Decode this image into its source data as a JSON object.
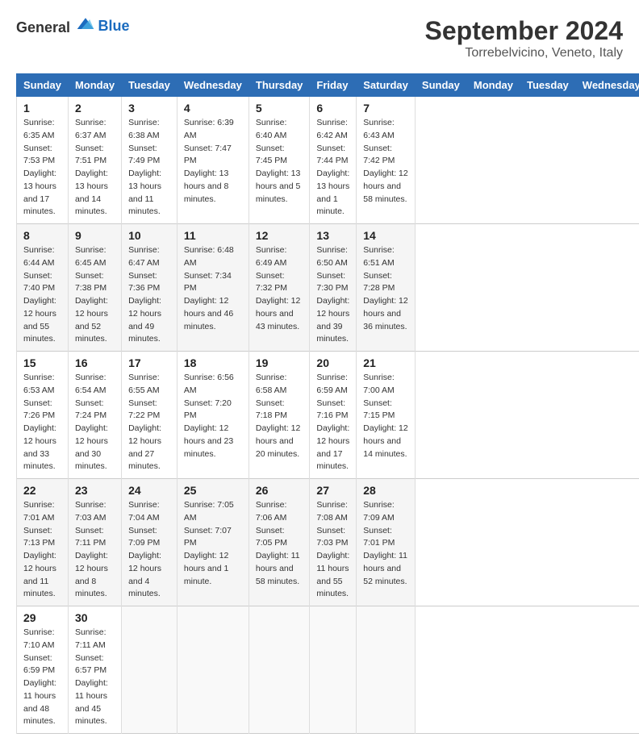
{
  "header": {
    "logo_general": "General",
    "logo_blue": "Blue",
    "month_title": "September 2024",
    "location": "Torrebelvicino, Veneto, Italy"
  },
  "columns": [
    "Sunday",
    "Monday",
    "Tuesday",
    "Wednesday",
    "Thursday",
    "Friday",
    "Saturday"
  ],
  "weeks": [
    [
      {
        "day": "1",
        "sunrise": "Sunrise: 6:35 AM",
        "sunset": "Sunset: 7:53 PM",
        "daylight": "Daylight: 13 hours and 17 minutes."
      },
      {
        "day": "2",
        "sunrise": "Sunrise: 6:37 AM",
        "sunset": "Sunset: 7:51 PM",
        "daylight": "Daylight: 13 hours and 14 minutes."
      },
      {
        "day": "3",
        "sunrise": "Sunrise: 6:38 AM",
        "sunset": "Sunset: 7:49 PM",
        "daylight": "Daylight: 13 hours and 11 minutes."
      },
      {
        "day": "4",
        "sunrise": "Sunrise: 6:39 AM",
        "sunset": "Sunset: 7:47 PM",
        "daylight": "Daylight: 13 hours and 8 minutes."
      },
      {
        "day": "5",
        "sunrise": "Sunrise: 6:40 AM",
        "sunset": "Sunset: 7:45 PM",
        "daylight": "Daylight: 13 hours and 5 minutes."
      },
      {
        "day": "6",
        "sunrise": "Sunrise: 6:42 AM",
        "sunset": "Sunset: 7:44 PM",
        "daylight": "Daylight: 13 hours and 1 minute."
      },
      {
        "day": "7",
        "sunrise": "Sunrise: 6:43 AM",
        "sunset": "Sunset: 7:42 PM",
        "daylight": "Daylight: 12 hours and 58 minutes."
      }
    ],
    [
      {
        "day": "8",
        "sunrise": "Sunrise: 6:44 AM",
        "sunset": "Sunset: 7:40 PM",
        "daylight": "Daylight: 12 hours and 55 minutes."
      },
      {
        "day": "9",
        "sunrise": "Sunrise: 6:45 AM",
        "sunset": "Sunset: 7:38 PM",
        "daylight": "Daylight: 12 hours and 52 minutes."
      },
      {
        "day": "10",
        "sunrise": "Sunrise: 6:47 AM",
        "sunset": "Sunset: 7:36 PM",
        "daylight": "Daylight: 12 hours and 49 minutes."
      },
      {
        "day": "11",
        "sunrise": "Sunrise: 6:48 AM",
        "sunset": "Sunset: 7:34 PM",
        "daylight": "Daylight: 12 hours and 46 minutes."
      },
      {
        "day": "12",
        "sunrise": "Sunrise: 6:49 AM",
        "sunset": "Sunset: 7:32 PM",
        "daylight": "Daylight: 12 hours and 43 minutes."
      },
      {
        "day": "13",
        "sunrise": "Sunrise: 6:50 AM",
        "sunset": "Sunset: 7:30 PM",
        "daylight": "Daylight: 12 hours and 39 minutes."
      },
      {
        "day": "14",
        "sunrise": "Sunrise: 6:51 AM",
        "sunset": "Sunset: 7:28 PM",
        "daylight": "Daylight: 12 hours and 36 minutes."
      }
    ],
    [
      {
        "day": "15",
        "sunrise": "Sunrise: 6:53 AM",
        "sunset": "Sunset: 7:26 PM",
        "daylight": "Daylight: 12 hours and 33 minutes."
      },
      {
        "day": "16",
        "sunrise": "Sunrise: 6:54 AM",
        "sunset": "Sunset: 7:24 PM",
        "daylight": "Daylight: 12 hours and 30 minutes."
      },
      {
        "day": "17",
        "sunrise": "Sunrise: 6:55 AM",
        "sunset": "Sunset: 7:22 PM",
        "daylight": "Daylight: 12 hours and 27 minutes."
      },
      {
        "day": "18",
        "sunrise": "Sunrise: 6:56 AM",
        "sunset": "Sunset: 7:20 PM",
        "daylight": "Daylight: 12 hours and 23 minutes."
      },
      {
        "day": "19",
        "sunrise": "Sunrise: 6:58 AM",
        "sunset": "Sunset: 7:18 PM",
        "daylight": "Daylight: 12 hours and 20 minutes."
      },
      {
        "day": "20",
        "sunrise": "Sunrise: 6:59 AM",
        "sunset": "Sunset: 7:16 PM",
        "daylight": "Daylight: 12 hours and 17 minutes."
      },
      {
        "day": "21",
        "sunrise": "Sunrise: 7:00 AM",
        "sunset": "Sunset: 7:15 PM",
        "daylight": "Daylight: 12 hours and 14 minutes."
      }
    ],
    [
      {
        "day": "22",
        "sunrise": "Sunrise: 7:01 AM",
        "sunset": "Sunset: 7:13 PM",
        "daylight": "Daylight: 12 hours and 11 minutes."
      },
      {
        "day": "23",
        "sunrise": "Sunrise: 7:03 AM",
        "sunset": "Sunset: 7:11 PM",
        "daylight": "Daylight: 12 hours and 8 minutes."
      },
      {
        "day": "24",
        "sunrise": "Sunrise: 7:04 AM",
        "sunset": "Sunset: 7:09 PM",
        "daylight": "Daylight: 12 hours and 4 minutes."
      },
      {
        "day": "25",
        "sunrise": "Sunrise: 7:05 AM",
        "sunset": "Sunset: 7:07 PM",
        "daylight": "Daylight: 12 hours and 1 minute."
      },
      {
        "day": "26",
        "sunrise": "Sunrise: 7:06 AM",
        "sunset": "Sunset: 7:05 PM",
        "daylight": "Daylight: 11 hours and 58 minutes."
      },
      {
        "day": "27",
        "sunrise": "Sunrise: 7:08 AM",
        "sunset": "Sunset: 7:03 PM",
        "daylight": "Daylight: 11 hours and 55 minutes."
      },
      {
        "day": "28",
        "sunrise": "Sunrise: 7:09 AM",
        "sunset": "Sunset: 7:01 PM",
        "daylight": "Daylight: 11 hours and 52 minutes."
      }
    ],
    [
      {
        "day": "29",
        "sunrise": "Sunrise: 7:10 AM",
        "sunset": "Sunset: 6:59 PM",
        "daylight": "Daylight: 11 hours and 48 minutes."
      },
      {
        "day": "30",
        "sunrise": "Sunrise: 7:11 AM",
        "sunset": "Sunset: 6:57 PM",
        "daylight": "Daylight: 11 hours and 45 minutes."
      },
      null,
      null,
      null,
      null,
      null
    ]
  ]
}
